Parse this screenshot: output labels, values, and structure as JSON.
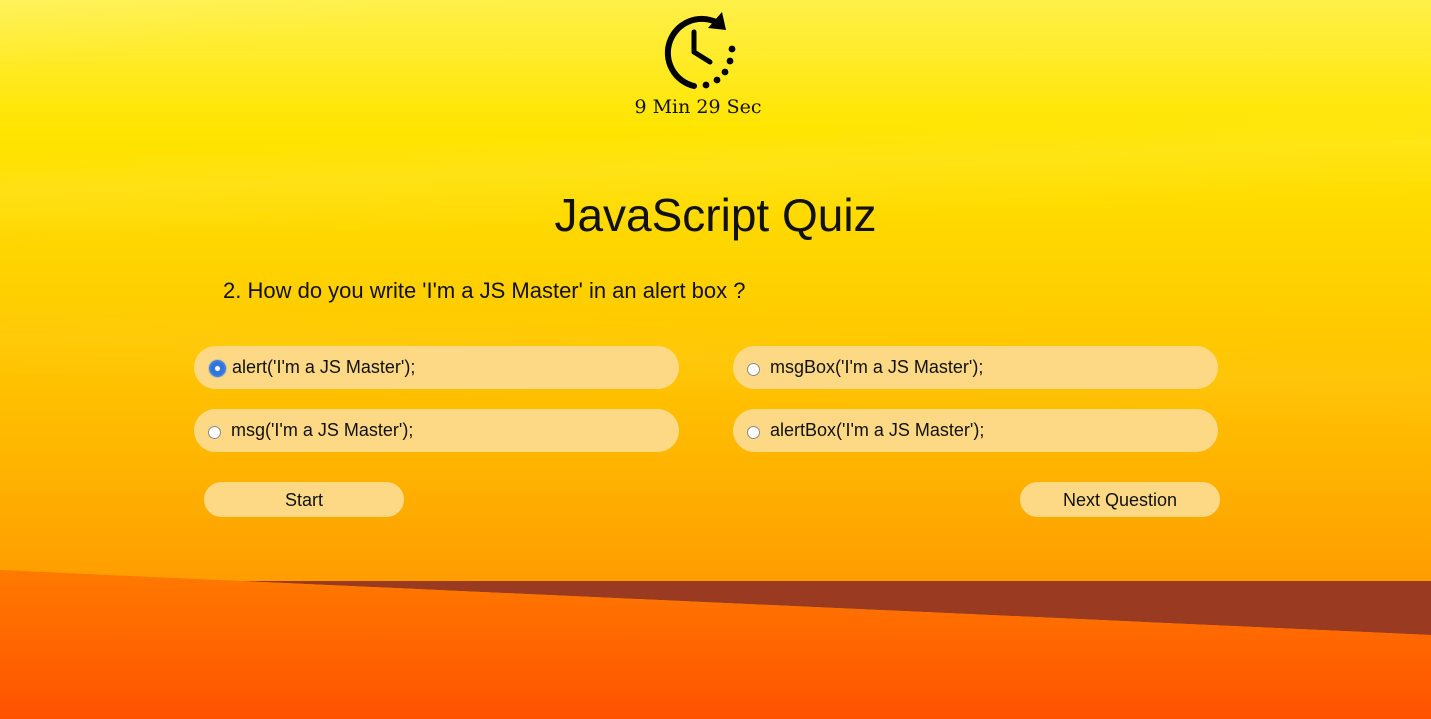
{
  "timer": {
    "icon": "timer-clock-icon",
    "text": "9 Min 29 Sec"
  },
  "quiz": {
    "title": "JavaScript Quiz",
    "question": "2. How do you write 'I'm a JS Master' in an alert box ?",
    "options": [
      {
        "label": "alert('I'm a JS Master');",
        "selected": true
      },
      {
        "label": "msgBox('I'm a JS Master');",
        "selected": false
      },
      {
        "label": "msg('I'm a JS Master');",
        "selected": false
      },
      {
        "label": "alertBox('I'm a JS Master');",
        "selected": false
      }
    ]
  },
  "buttons": {
    "start_label": "Start",
    "next_label": "Next Question"
  },
  "colors": {
    "option_bg": "#fdd985",
    "radio_selected": "#2e74de",
    "text": "#111111"
  }
}
